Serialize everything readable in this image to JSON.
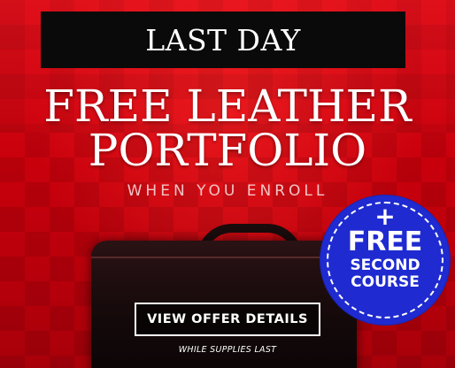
{
  "banner": {
    "top_label": "LAST DAY",
    "headline_line1": "FREE LEATHER",
    "headline_line2": "PORTFOLIO",
    "subheadline": "WHEN YOU ENROLL",
    "badge": {
      "plus": "+",
      "line1": "FREE",
      "line2": "SECOND",
      "line3": "COURSE"
    },
    "cta_label": "VIEW OFFER DETAILS",
    "footnote": "WHILE SUPPLIES LAST"
  },
  "colors": {
    "background": "#c8000c",
    "badge": "#1f2bd0",
    "top_box": "#0a0a0a",
    "text": "#ffffff"
  },
  "icons": {
    "product_image": "leather-portfolio-icon"
  }
}
